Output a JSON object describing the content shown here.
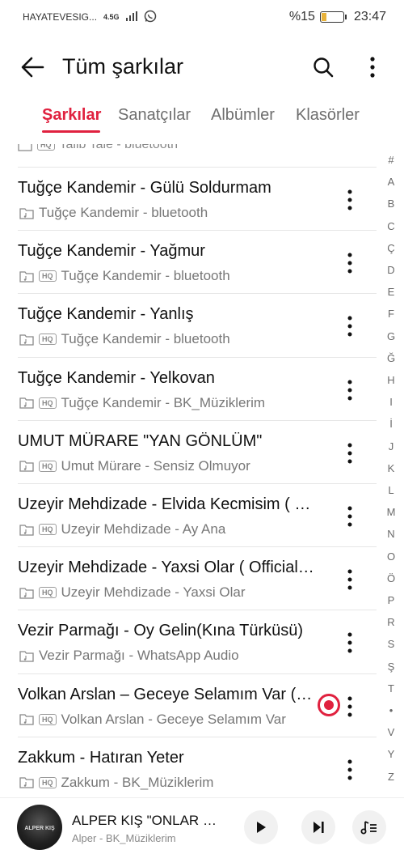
{
  "status_bar": {
    "carrier": "HAYATEVESIG...",
    "network": "4.5G",
    "battery_percent": "%15",
    "time": "23:47"
  },
  "header": {
    "title": "Tüm şarkılar",
    "icons": [
      "back-arrow-icon",
      "search-icon",
      "more-vertical-icon"
    ]
  },
  "tabs": [
    {
      "label": "Şarkılar",
      "active": true
    },
    {
      "label": "Sanatçılar",
      "active": false
    },
    {
      "label": "Albümler",
      "active": false
    },
    {
      "label": "Klasörler",
      "active": false
    }
  ],
  "partial_row": {
    "text": "Talib Tale - bluetooth"
  },
  "songs": [
    {
      "title": "Tuğçe Kandemir - Gülü Soldurmam",
      "subtitle": "Tuğçe Kandemir - bluetooth",
      "hq": false,
      "playing": false
    },
    {
      "title": "Tuğçe Kandemir - Yağmur",
      "subtitle": "Tuğçe Kandemir - bluetooth",
      "hq": true,
      "playing": false
    },
    {
      "title": "Tuğçe Kandemir - Yanlış",
      "subtitle": "Tuğçe Kandemir - bluetooth",
      "hq": true,
      "playing": false
    },
    {
      "title": "Tuğçe Kandemir - Yelkovan",
      "subtitle": "Tuğçe Kandemir - BK_Müziklerim",
      "hq": true,
      "playing": false
    },
    {
      "title": "UMUT MÜRARE \"YAN GÖNLÜM\"",
      "subtitle": "Umut Mürare - Sensiz Olmuyor",
      "hq": true,
      "playing": false
    },
    {
      "title": "Uzeyir Mehdizade - Elvida Kecmisim  ( Official Video )",
      "subtitle": "Uzeyir Mehdizade - Ay Ana",
      "hq": true,
      "playing": false
    },
    {
      "title": "Uzeyir Mehdizade - Yaxsi Olar  ( Official Video )",
      "subtitle": "Uzeyir Mehdizade - Yaxsi Olar",
      "hq": true,
      "playing": false
    },
    {
      "title": "Vezir Parmağı - Oy Gelin(Kına Türküsü)",
      "subtitle": "Vezir Parmağı - WhatsApp Audio",
      "hq": false,
      "playing": false
    },
    {
      "title": "Volkan Arslan – Geceye Selamım Var (Official Video)",
      "subtitle": "Volkan Arslan - Geceye Selamım Var",
      "hq": true,
      "playing": true
    },
    {
      "title": "Zakkum - Hatıran Yeter",
      "subtitle": "Zakkum - BK_Müziklerim",
      "hq": true,
      "playing": false
    }
  ],
  "hq_label": "HQ",
  "alphabet": [
    "#",
    "A",
    "B",
    "C",
    "Ç",
    "D",
    "E",
    "F",
    "G",
    "Ğ",
    "H",
    "I",
    "İ",
    "J",
    "K",
    "L",
    "M",
    "N",
    "O",
    "Ö",
    "P",
    "R",
    "S",
    "Ş",
    "T",
    "•",
    "V",
    "Y",
    "Z"
  ],
  "now_playing": {
    "title": "ALPER KIŞ  \"ONLAR ÖLDÜ\"",
    "subtitle": "Alper - BK_Müziklerim",
    "album_art_text": "ALPER KIŞ",
    "controls": [
      "play-icon",
      "next-icon",
      "playlist-icon"
    ]
  },
  "colors": {
    "accent": "#e0213f",
    "text_primary": "#111111",
    "text_secondary": "#777777",
    "divider": "#e6e6e6"
  }
}
